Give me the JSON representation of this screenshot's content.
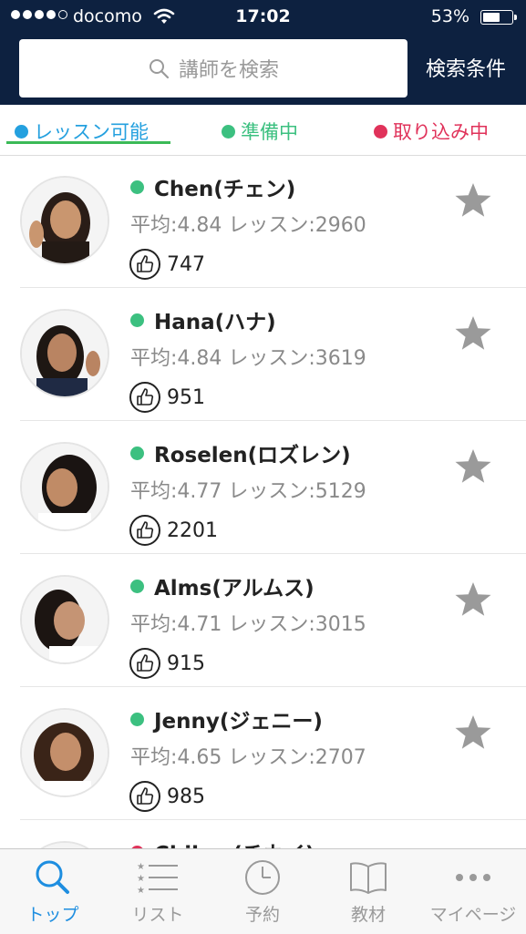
{
  "status_bar": {
    "carrier": "docomo",
    "time": "17:02",
    "battery": "53%",
    "battery_level": 0.53
  },
  "header": {
    "search_placeholder": "講師を検索",
    "search_conditions": "検索条件"
  },
  "filters": [
    {
      "label": "レッスン可能",
      "color": "#24a0df",
      "selected": true
    },
    {
      "label": "準備中",
      "color": "#3cc080",
      "selected": false
    },
    {
      "label": "取り込み中",
      "color": "#e0325a",
      "selected": false
    }
  ],
  "teachers": [
    {
      "name": "Chen(チェン)",
      "stats": "平均:4.84 レッスン:2960",
      "likes": "747",
      "status": "preparing"
    },
    {
      "name": "Hana(ハナ)",
      "stats": "平均:4.84 レッスン:3619",
      "likes": "951",
      "status": "preparing"
    },
    {
      "name": "Roselen(ロズレン)",
      "stats": "平均:4.77 レッスン:5129",
      "likes": "2201",
      "status": "preparing"
    },
    {
      "name": "Alms(アルムス)",
      "stats": "平均:4.71 レッスン:3015",
      "likes": "915",
      "status": "preparing"
    },
    {
      "name": "Jenny(ジェニー)",
      "stats": "平均:4.65 レッスン:2707",
      "likes": "985",
      "status": "preparing"
    },
    {
      "name": "Chikay(チカイ)",
      "stats": "",
      "likes": "",
      "status": "busy"
    }
  ],
  "tabs": [
    {
      "label": "トップ",
      "icon": "search-icon",
      "active": true
    },
    {
      "label": "リスト",
      "icon": "list-icon",
      "active": false
    },
    {
      "label": "予約",
      "icon": "clock-icon",
      "active": false
    },
    {
      "label": "教材",
      "icon": "book-icon",
      "active": false
    },
    {
      "label": "マイページ",
      "icon": "more-icon",
      "active": false
    }
  ],
  "colors": {
    "header_bg": "#0d2140",
    "available": "#24a0df",
    "preparing": "#3cc080",
    "busy": "#e0325a",
    "tab_active": "#1e8ee0"
  }
}
